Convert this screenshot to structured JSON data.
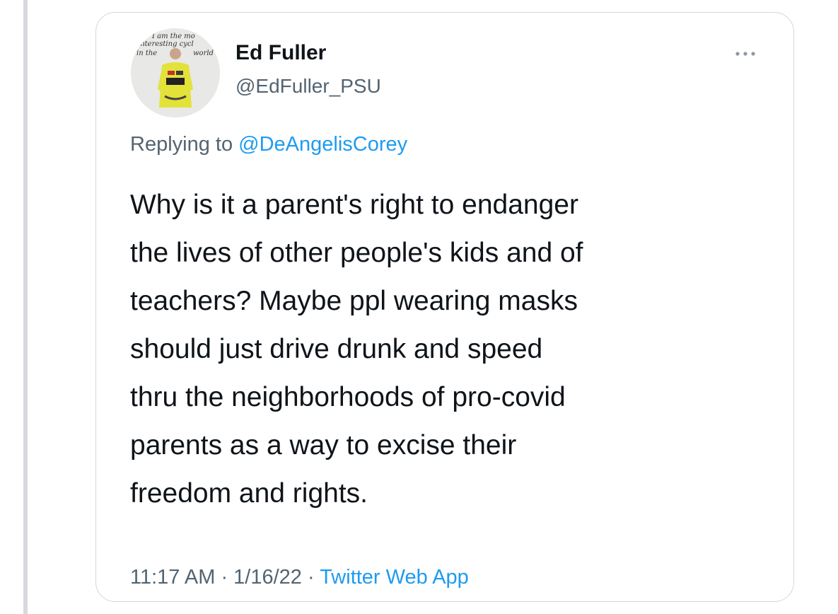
{
  "tweet": {
    "display_name": "Ed Fuller",
    "handle": "@EdFuller_PSU",
    "avatar_caption": {
      "line1": "I am the mo",
      "line2": "interesting cycl",
      "line3_left": "in the",
      "line3_right": "world"
    },
    "more_icon": "more-dots-icon",
    "replying_prefix": "Replying to ",
    "replying_to": "@DeAngelisCorey",
    "text": "Why is it a parent's right to endanger\nthe lives of other people's kids and of\nteachers? Maybe ppl wearing masks\nshould just drive drunk and speed\nthru the neighborhoods of pro-covid\nparents as a way to excise their\nfreedom and rights.",
    "time": "11:17 AM",
    "separator": " · ",
    "date": "1/16/22",
    "source": "Twitter Web App"
  },
  "colors": {
    "text_primary": "#0f1419",
    "text_secondary": "#536471",
    "link": "#1d9bf0",
    "border": "#cfd9de"
  }
}
